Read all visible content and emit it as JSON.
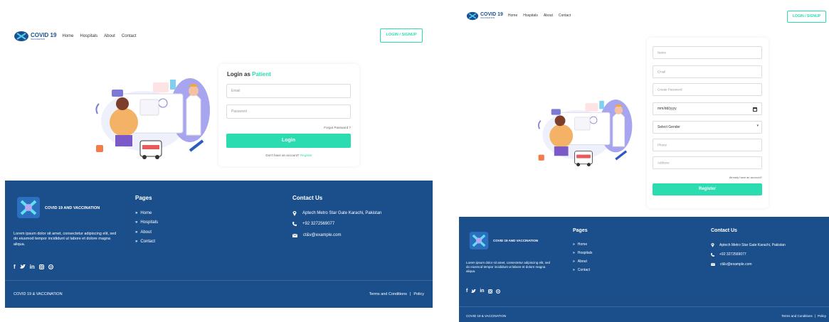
{
  "brand": {
    "logo_main": "COVID 19",
    "logo_sub": "VACCINATION",
    "footer_name": "COVID 19 AND VACCINATION",
    "copyright": "COVID 19 & VACCINATION"
  },
  "nav": {
    "links": [
      "Home",
      "Hospitals",
      "About",
      "Contact"
    ],
    "cta": "LOGIN / SIGNUP"
  },
  "login": {
    "title_prefix": "Login as",
    "title_role": "Patient",
    "email_placeholder": "Email",
    "password_placeholder": "Password",
    "forgot": "Forgot Password ?",
    "submit": "Login",
    "no_account": "Don't have an account?",
    "register_link": "Register"
  },
  "register": {
    "name_placeholder": "Name",
    "email_placeholder": "Email",
    "password_placeholder": "Create Password",
    "date_placeholder": "mm/dd/yyyy",
    "gender_placeholder": "Select Gender",
    "phone_placeholder": "Phone",
    "address_placeholder": "Address",
    "have_account": "Already have an account?",
    "submit": "Register"
  },
  "footer": {
    "about": "Lorem ipsum dolor sit amet, consectetur adipiscing elit, sed do eiusmod tempor incididunt ut labore et dolore magna aliqua.",
    "pages_title": "Pages",
    "pages": [
      "Home",
      "Hospitals",
      "About",
      "Contact"
    ],
    "contact_title": "Contact Us",
    "address": "Aptech Metro Star Gate Karachi, Pakistan",
    "phone": "+92 3272569077",
    "email": "ct&v@example.com",
    "terms": "Terms and Conditions",
    "separator": "|",
    "policy": "Policy"
  },
  "colors": {
    "accent": "#2bdcb1",
    "footer_bg": "#1a4f8c",
    "brand_blue": "#1b4f8f"
  },
  "icons": {
    "pages_bullet": "double-chevron-right-icon",
    "address": "map-pin-icon",
    "phone": "phone-icon",
    "email": "envelope-icon",
    "social": [
      "facebook-icon",
      "twitter-icon",
      "linkedin-icon",
      "instagram-icon",
      "dribbble-icon"
    ]
  }
}
